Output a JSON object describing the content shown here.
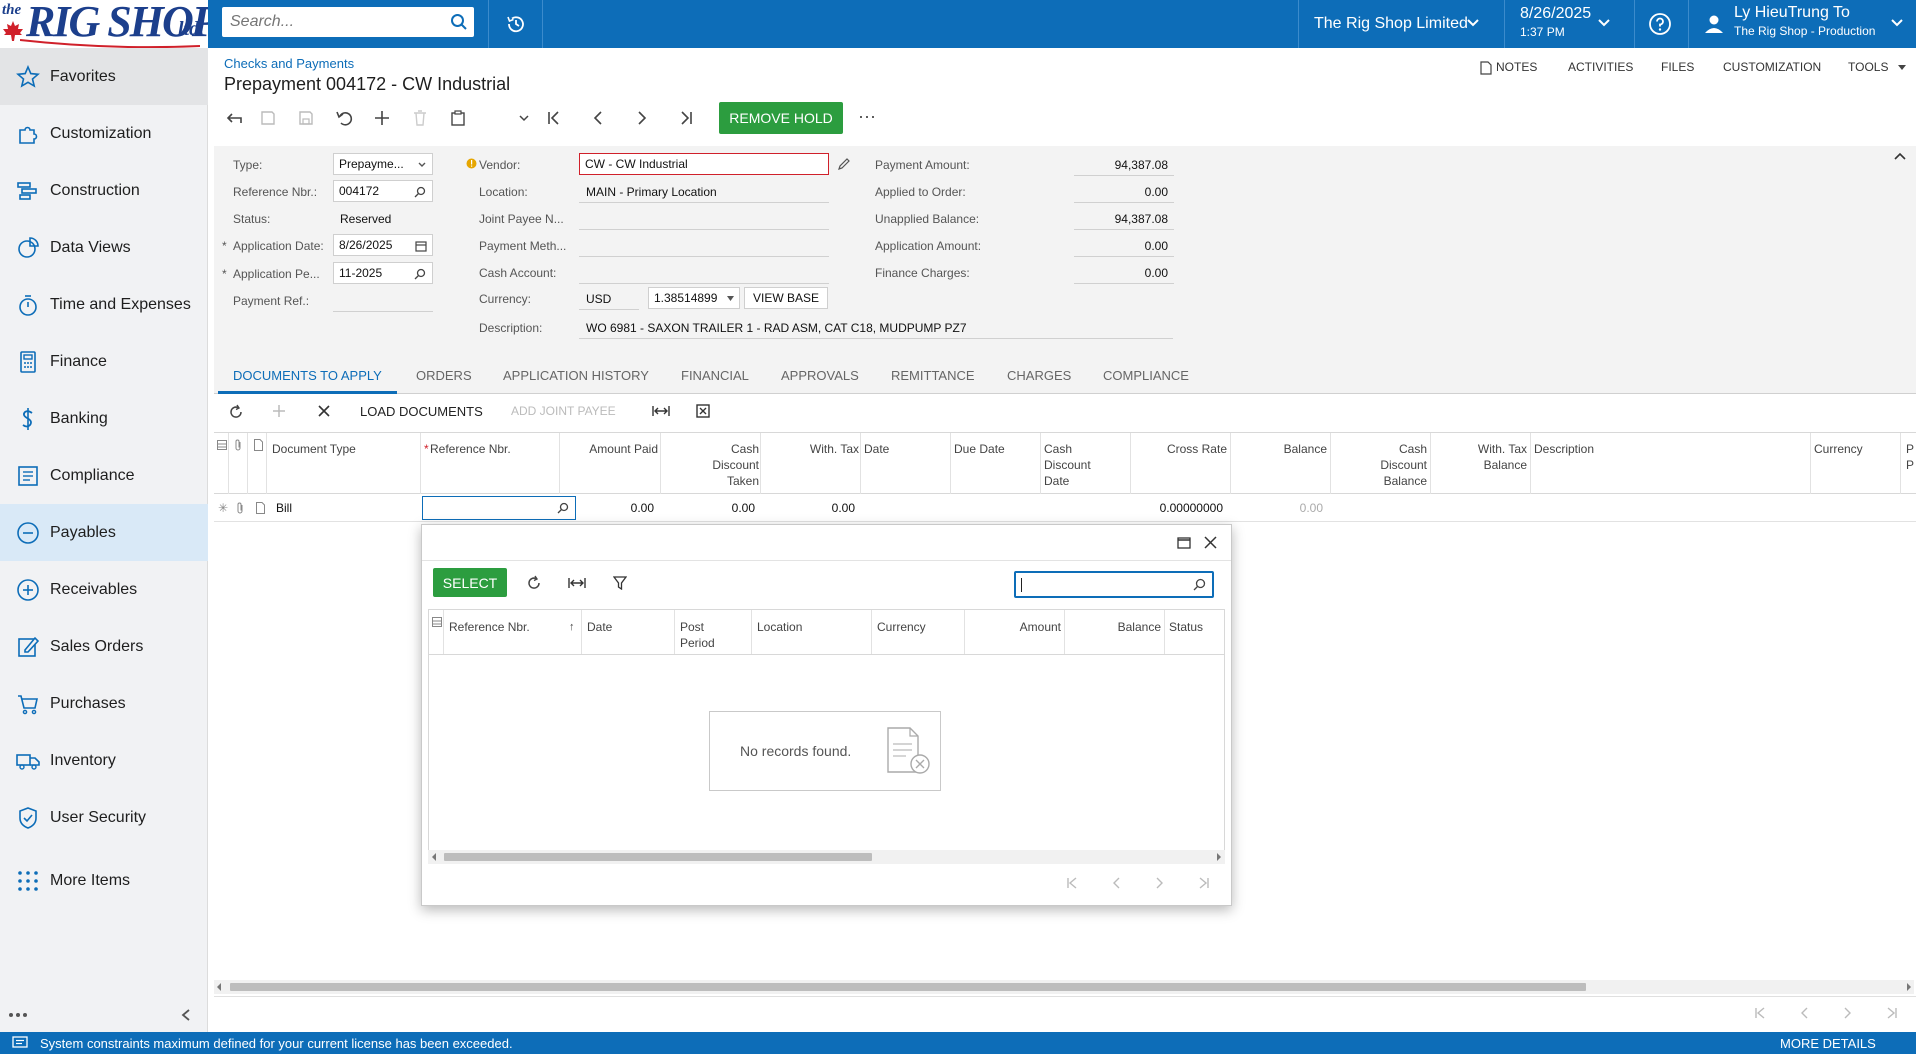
{
  "brand": {
    "logo_the": "the",
    "logo_main": "RIG SHOP",
    "logo_ltd": "ltd."
  },
  "header": {
    "search_placeholder": "Search...",
    "company": "The Rig Shop Limited",
    "date": "8/26/2025",
    "time": "1:37 PM",
    "user_name": "Ly HieuTrung To",
    "user_tenant": "The Rig Shop - Production"
  },
  "sidebar": {
    "items": [
      {
        "label": "Favorites",
        "icon": "star-icon"
      },
      {
        "label": "Customization",
        "icon": "puzzle-icon"
      },
      {
        "label": "Construction",
        "icon": "gantt-icon"
      },
      {
        "label": "Data Views",
        "icon": "pie-chart-icon"
      },
      {
        "label": "Time and Expenses",
        "icon": "stopwatch-icon"
      },
      {
        "label": "Finance",
        "icon": "calculator-icon"
      },
      {
        "label": "Banking",
        "icon": "dollar-icon"
      },
      {
        "label": "Compliance",
        "icon": "checklist-icon"
      },
      {
        "label": "Payables",
        "icon": "minus-circle-icon"
      },
      {
        "label": "Receivables",
        "icon": "plus-circle-icon"
      },
      {
        "label": "Sales Orders",
        "icon": "edit-icon"
      },
      {
        "label": "Purchases",
        "icon": "cart-icon"
      },
      {
        "label": "Inventory",
        "icon": "truck-icon"
      },
      {
        "label": "User Security",
        "icon": "shield-icon"
      },
      {
        "label": "More Items",
        "icon": "grid-dots-icon"
      }
    ]
  },
  "page": {
    "breadcrumb": "Checks and Payments",
    "title": "Prepayment 004172 - CW Industrial",
    "links": {
      "notes": "NOTES",
      "activities": "ACTIVITIES",
      "files": "FILES",
      "customization": "CUSTOMIZATION",
      "tools": "TOOLS"
    },
    "remove_hold": "REMOVE HOLD",
    "more": "···"
  },
  "form": {
    "type_label": "Type:",
    "type_value": "Prepayme...",
    "refnbr_label": "Reference Nbr.:",
    "refnbr_value": "004172",
    "status_label": "Status:",
    "status_value": "Reserved",
    "appdate_label": "Application Date:",
    "appdate_value": "8/26/2025",
    "appperiod_label": "Application Pe...",
    "appperiod_value": "11-2025",
    "payref_label": "Payment Ref.:",
    "vendor_label": "Vendor:",
    "vendor_value": "CW - CW Industrial",
    "location_label": "Location:",
    "location_value": "MAIN - Primary Location",
    "jointpayee_label": "Joint Payee N...",
    "paymethod_label": "Payment Meth...",
    "cashacct_label": "Cash Account:",
    "currency_label": "Currency:",
    "currency_value": "USD",
    "rate_value": "1.38514899",
    "view_base": "VIEW BASE",
    "description_label": "Description:",
    "description_value": "WO 6981 - SAXON TRAILER 1 - RAD ASM, CAT C18, MUDPUMP PZ7",
    "payamt_label": "Payment Amount:",
    "payamt_value": "94,387.08",
    "applied_label": "Applied to Order:",
    "applied_value": "0.00",
    "unapplied_label": "Unapplied Balance:",
    "unapplied_value": "94,387.08",
    "appamt_label": "Application Amount:",
    "appamt_value": "0.00",
    "fincharge_label": "Finance Charges:",
    "fincharge_value": "0.00"
  },
  "tabs": [
    "DOCUMENTS TO APPLY",
    "ORDERS",
    "APPLICATION HISTORY",
    "FINANCIAL",
    "APPROVALS",
    "REMITTANCE",
    "CHARGES",
    "COMPLIANCE"
  ],
  "grid": {
    "load_documents": "LOAD DOCUMENTS",
    "add_joint_payee": "ADD JOINT PAYEE",
    "headers": {
      "doc_type": "Document Type",
      "ref_nbr": "Reference Nbr.",
      "amount_paid": "Amount Paid",
      "cash_disc_1": "Cash",
      "cash_disc_2": "Discount",
      "cash_disc_3": "Taken",
      "with_tax": "With. Tax",
      "date": "Date",
      "due_date": "Due Date",
      "cdd_1": "Cash",
      "cdd_2": "Discount",
      "cdd_3": "Date",
      "cross_rate": "Cross Rate",
      "balance": "Balance",
      "cdb_1": "Cash",
      "cdb_2": "Discount",
      "cdb_3": "Balance",
      "wtb_1": "With. Tax",
      "wtb_2": "Balance",
      "description": "Description",
      "currency": "Currency",
      "trunc_1": "P",
      "trunc_2": "P"
    },
    "row": {
      "doc_type": "Bill",
      "amount_paid": "0.00",
      "cash_disc": "0.00",
      "with_tax": "0.00",
      "cross_rate": "0.00000000",
      "balance": "0.00"
    }
  },
  "popup": {
    "select": "SELECT",
    "headers": {
      "ref_nbr": "Reference Nbr.",
      "date": "Date",
      "post_1": "Post",
      "post_2": "Period",
      "location": "Location",
      "currency": "Currency",
      "amount": "Amount",
      "balance": "Balance",
      "status": "Status"
    },
    "empty": "No records found."
  },
  "statusbar": {
    "message": "System constraints maximum defined for your current license has been exceeded.",
    "more": "MORE DETAILS"
  }
}
